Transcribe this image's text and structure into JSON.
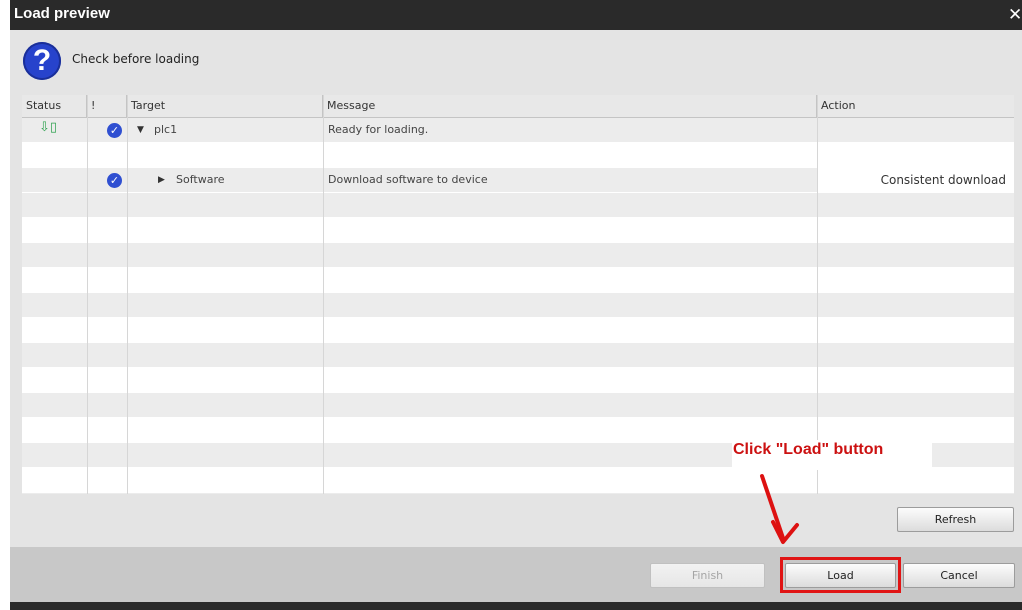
{
  "window": {
    "title": "Load preview",
    "close_glyph": "✕",
    "help_glyph": "?",
    "subtitle": "Check before loading"
  },
  "grid": {
    "columns": [
      "Status",
      "!",
      "Target",
      "Message",
      "Action"
    ],
    "rows": [
      {
        "status_icon": "download-to-plc-icon",
        "status_glyph": "⇩▯",
        "checked": true,
        "expander": "▼",
        "target": "plc1",
        "message": "Ready for loading.",
        "action": ""
      },
      {
        "status_icon": "",
        "checked": false,
        "expander": "",
        "target": "",
        "message": "",
        "action": ""
      },
      {
        "status_icon": "",
        "checked": true,
        "expander": "▶",
        "target": "Software",
        "message": "Download software to device",
        "action": "Consistent download"
      }
    ]
  },
  "buttons": {
    "refresh": "Refresh",
    "finish": "Finish",
    "load": "Load",
    "cancel": "Cancel"
  },
  "annotation": {
    "text": "Click \"Load\" button",
    "color": "#cc1111"
  },
  "colors": {
    "check_blue": "#2f4fd1",
    "title_bar": "#2a2a2a",
    "highlight_red": "#e01414"
  }
}
